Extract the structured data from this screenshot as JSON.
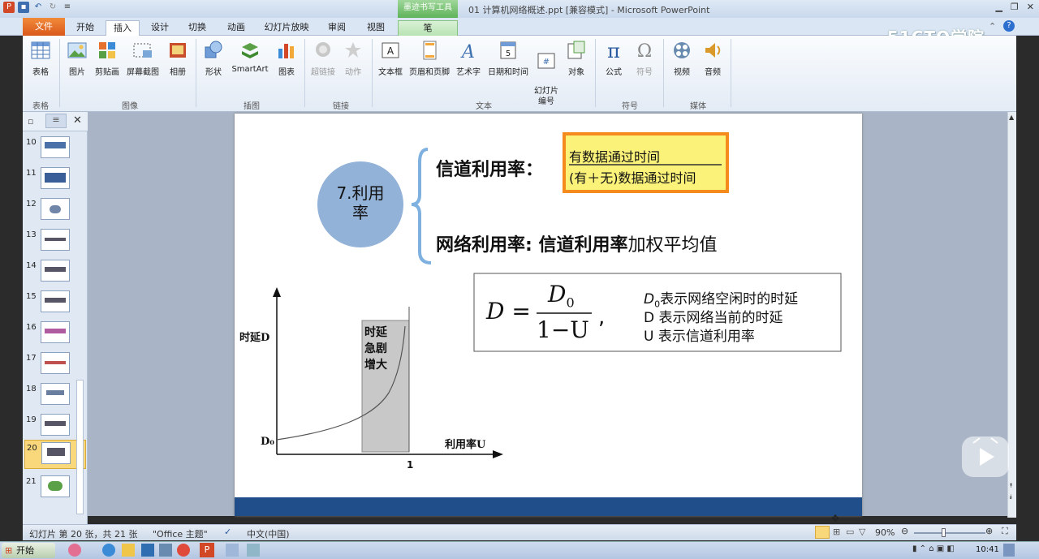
{
  "window": {
    "title": "01 计算机网络概述.ppt [兼容模式]  -  Microsoft PowerPoint",
    "context_tab_group": "墨迹书写工具"
  },
  "tabs": [
    "文件",
    "开始",
    "插入",
    "设计",
    "切换",
    "动画",
    "幻灯片放映",
    "审阅",
    "视图",
    "笔"
  ],
  "active_tab": "插入",
  "watermark": "51CTO学院",
  "ribbon": {
    "buttons": [
      {
        "label": "表格",
        "icon": "table-icon"
      },
      {
        "label": "图片",
        "icon": "picture-icon"
      },
      {
        "label": "剪贴画",
        "icon": "clipart-icon"
      },
      {
        "label": "屏幕截图",
        "icon": "screenshot-icon"
      },
      {
        "label": "相册",
        "icon": "album-icon"
      },
      {
        "label": "形状",
        "icon": "shapes-icon"
      },
      {
        "label": "SmartArt",
        "icon": "smartart-icon"
      },
      {
        "label": "图表",
        "icon": "chart-icon"
      },
      {
        "label": "超链接",
        "icon": "hyperlink-icon"
      },
      {
        "label": "动作",
        "icon": "action-icon"
      },
      {
        "label": "文本框",
        "icon": "textbox-icon"
      },
      {
        "label": "页眉和页脚",
        "icon": "header-footer-icon"
      },
      {
        "label": "艺术字",
        "icon": "wordart-icon"
      },
      {
        "label": "日期和时间",
        "icon": "datetime-icon"
      },
      {
        "label": "幻灯片\n编号",
        "icon": "slide-number-icon"
      },
      {
        "label": "对象",
        "icon": "object-icon"
      },
      {
        "label": "公式",
        "icon": "equation-icon"
      },
      {
        "label": "符号",
        "icon": "symbol-icon"
      },
      {
        "label": "视频",
        "icon": "video-icon"
      },
      {
        "label": "音频",
        "icon": "audio-icon"
      }
    ],
    "groups": [
      "表格",
      "图像",
      "插图",
      "链接",
      "文本",
      "符号",
      "媒体"
    ]
  },
  "slides_panel": {
    "numbers": [
      "10",
      "11",
      "12",
      "13",
      "14",
      "15",
      "16",
      "17",
      "18",
      "19",
      "20",
      "21"
    ],
    "selected": "20"
  },
  "slide": {
    "circle_label_1": "7.利用",
    "circle_label_2": "率",
    "channel_label": "信道利用率：",
    "fraction_num": "有数据通过时间",
    "fraction_den": "(有＋无)数据通过时间",
    "network_bold": "网络利用率: 信道利用率",
    "network_rest": "加权平均值",
    "formula_lhs": "D",
    "formula_num": "D",
    "formula_num_sub": "0",
    "formula_den": "1−U",
    "legend_1": "表示网络空闲时的时延",
    "legend_1_var": "D",
    "legend_1_sub": "0",
    "legend_2": "D 表示网络当前的时延",
    "legend_3": "U 表示信道利用率",
    "chart_ylabel": "时延D",
    "chart_xlabel": "利用率U",
    "chart_d0": "D₀",
    "chart_x1": "1",
    "chart_note": [
      "时延",
      "急剧",
      "增大"
    ]
  },
  "status": {
    "slide_info": "幻灯片 第 20 张，共 21 张",
    "theme": "\"Office 主题\"",
    "lang": "中文(中国)",
    "zoom": "90%"
  },
  "taskbar": {
    "start": "开始",
    "clock": "10:41"
  }
}
